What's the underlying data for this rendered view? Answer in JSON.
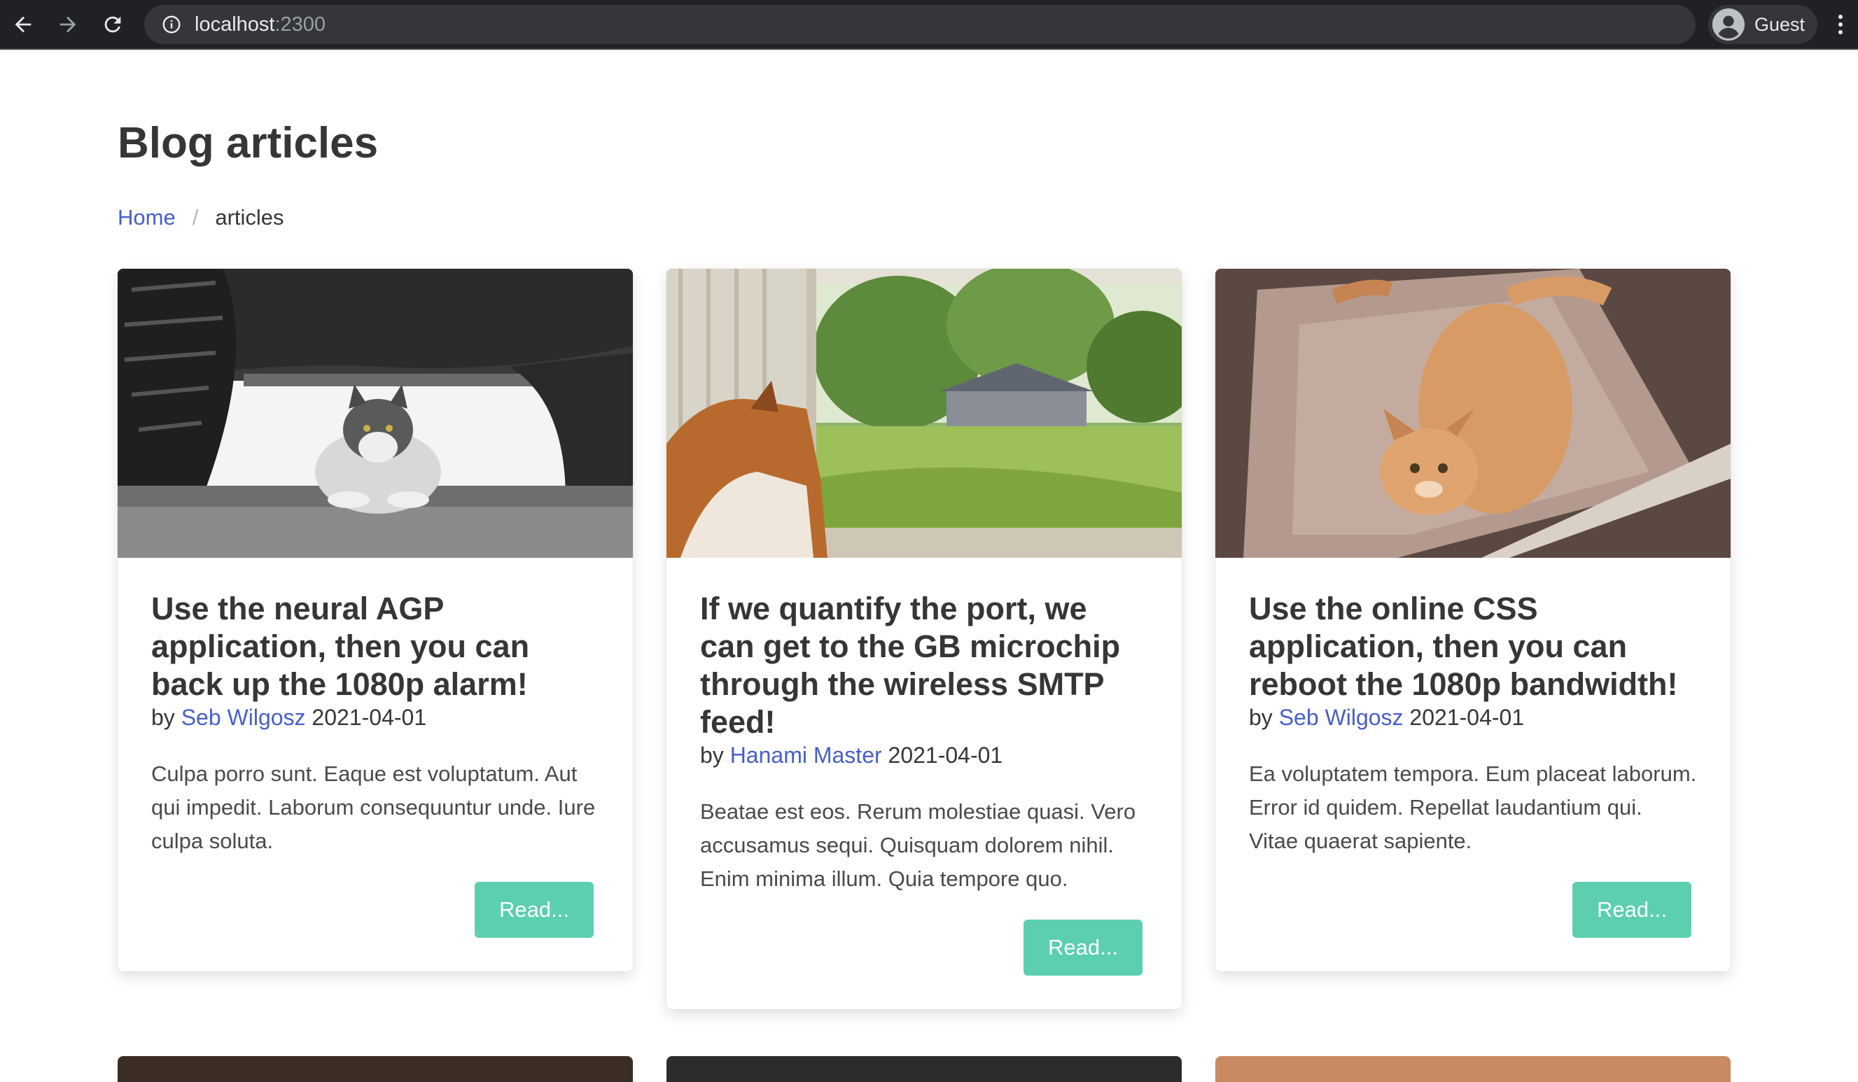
{
  "browser": {
    "url_host": "localhost",
    "url_port": ":2300",
    "profile_name": "Guest"
  },
  "page": {
    "title": "Blog articles",
    "breadcrumb": {
      "home": "Home",
      "separator": "/",
      "current": "articles"
    }
  },
  "articles": [
    {
      "title": "Use the neural AGP application, then you can back up the 1080p alarm!",
      "by": "by",
      "author": "Seb Wilgosz",
      "date": "2021-04-01",
      "excerpt": "Culpa porro sunt. Eaque est voluptatum. Aut qui impedit. Laborum consequuntur unde. Iure culpa soluta.",
      "read_label": "Read...",
      "image": "cat-under-car-photo"
    },
    {
      "title": "If we quantify the port, we can get to the GB microchip through the wireless SMTP feed!",
      "by": "by",
      "author": "Hanami Master",
      "date": "2021-04-01",
      "excerpt": "Beatae est eos. Rerum molestiae quasi. Vero accusamus sequi. Quisquam dolorem nihil. Enim minima illum. Quia tempore quo.",
      "read_label": "Read...",
      "image": "cat-window-photo"
    },
    {
      "title": "Use the online CSS application, then you can reboot the 1080p bandwidth!",
      "by": "by",
      "author": "Seb Wilgosz",
      "date": "2021-04-01",
      "excerpt": "Ea voluptatem tempora. Eum placeat laborum. Error id quidem. Repellat laudantium qui. Vitae quaerat sapiente.",
      "read_label": "Read...",
      "image": "cat-on-chair-photo"
    }
  ],
  "colors": {
    "link": "#485fc7",
    "button": "#5ccfb0",
    "chrome": "#202124"
  }
}
